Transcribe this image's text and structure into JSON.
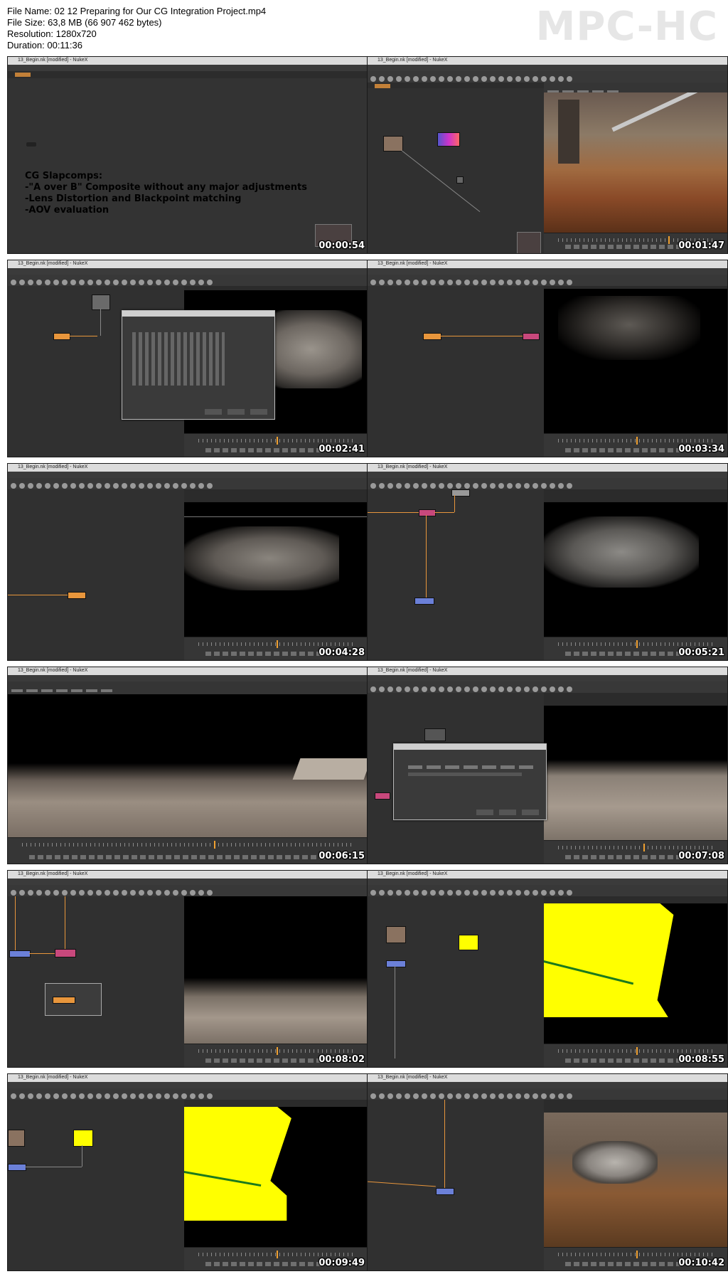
{
  "header": {
    "file_name": "File Name: 02 12 Preparing for Our CG Integration Project.mp4",
    "file_size": "File Size: 63,8 MB (66 907 462 bytes)",
    "resolution": "Resolution: 1280x720",
    "duration": "Duration: 00:11:36",
    "logo": "MPC-HC"
  },
  "thumbnails": [
    {
      "timestamp": "00:00:54",
      "window_title": "13_Begin.nk [modified] - NukeX"
    },
    {
      "timestamp": "00:01:47",
      "window_title": "13_Begin.nk [modified] - NukeX"
    },
    {
      "timestamp": "00:02:41",
      "window_title": "13_Begin.nk [modified] - NukeX"
    },
    {
      "timestamp": "00:03:34",
      "window_title": "13_Begin.nk [modified] - NukeX"
    },
    {
      "timestamp": "00:04:28",
      "window_title": "13_Begin.nk [modified] - NukeX"
    },
    {
      "timestamp": "00:05:21",
      "window_title": "13_Begin.nk [modified] - NukeX"
    },
    {
      "timestamp": "00:06:15",
      "window_title": "13_Begin.nk [modified] - NukeX"
    },
    {
      "timestamp": "00:07:08",
      "window_title": "13_Begin.nk [modified] - NukeX"
    },
    {
      "timestamp": "00:08:02",
      "window_title": "13_Begin.nk [modified] - NukeX"
    },
    {
      "timestamp": "00:08:55",
      "window_title": "13_Begin.nk [modified] - NukeX"
    },
    {
      "timestamp": "00:09:49",
      "window_title": "13_Begin.nk [modified] - NukeX"
    },
    {
      "timestamp": "00:10:42",
      "window_title": "13_Begin.nk [modified] - NukeX"
    }
  ],
  "slapcomp_note": {
    "heading": "CG Slapcomps:",
    "line1": "-\"A over B\" Composite without any major adjustments",
    "line2": "-Lens Distortion and Blackpoint matching",
    "line3": "-AOV evaluation"
  },
  "colors": {
    "node_orange": "#e8963c",
    "node_pink": "#c8487c",
    "node_blue": "#6b80d8",
    "ui_dark": "#303030",
    "viewer_yellow": "#ffff00"
  }
}
